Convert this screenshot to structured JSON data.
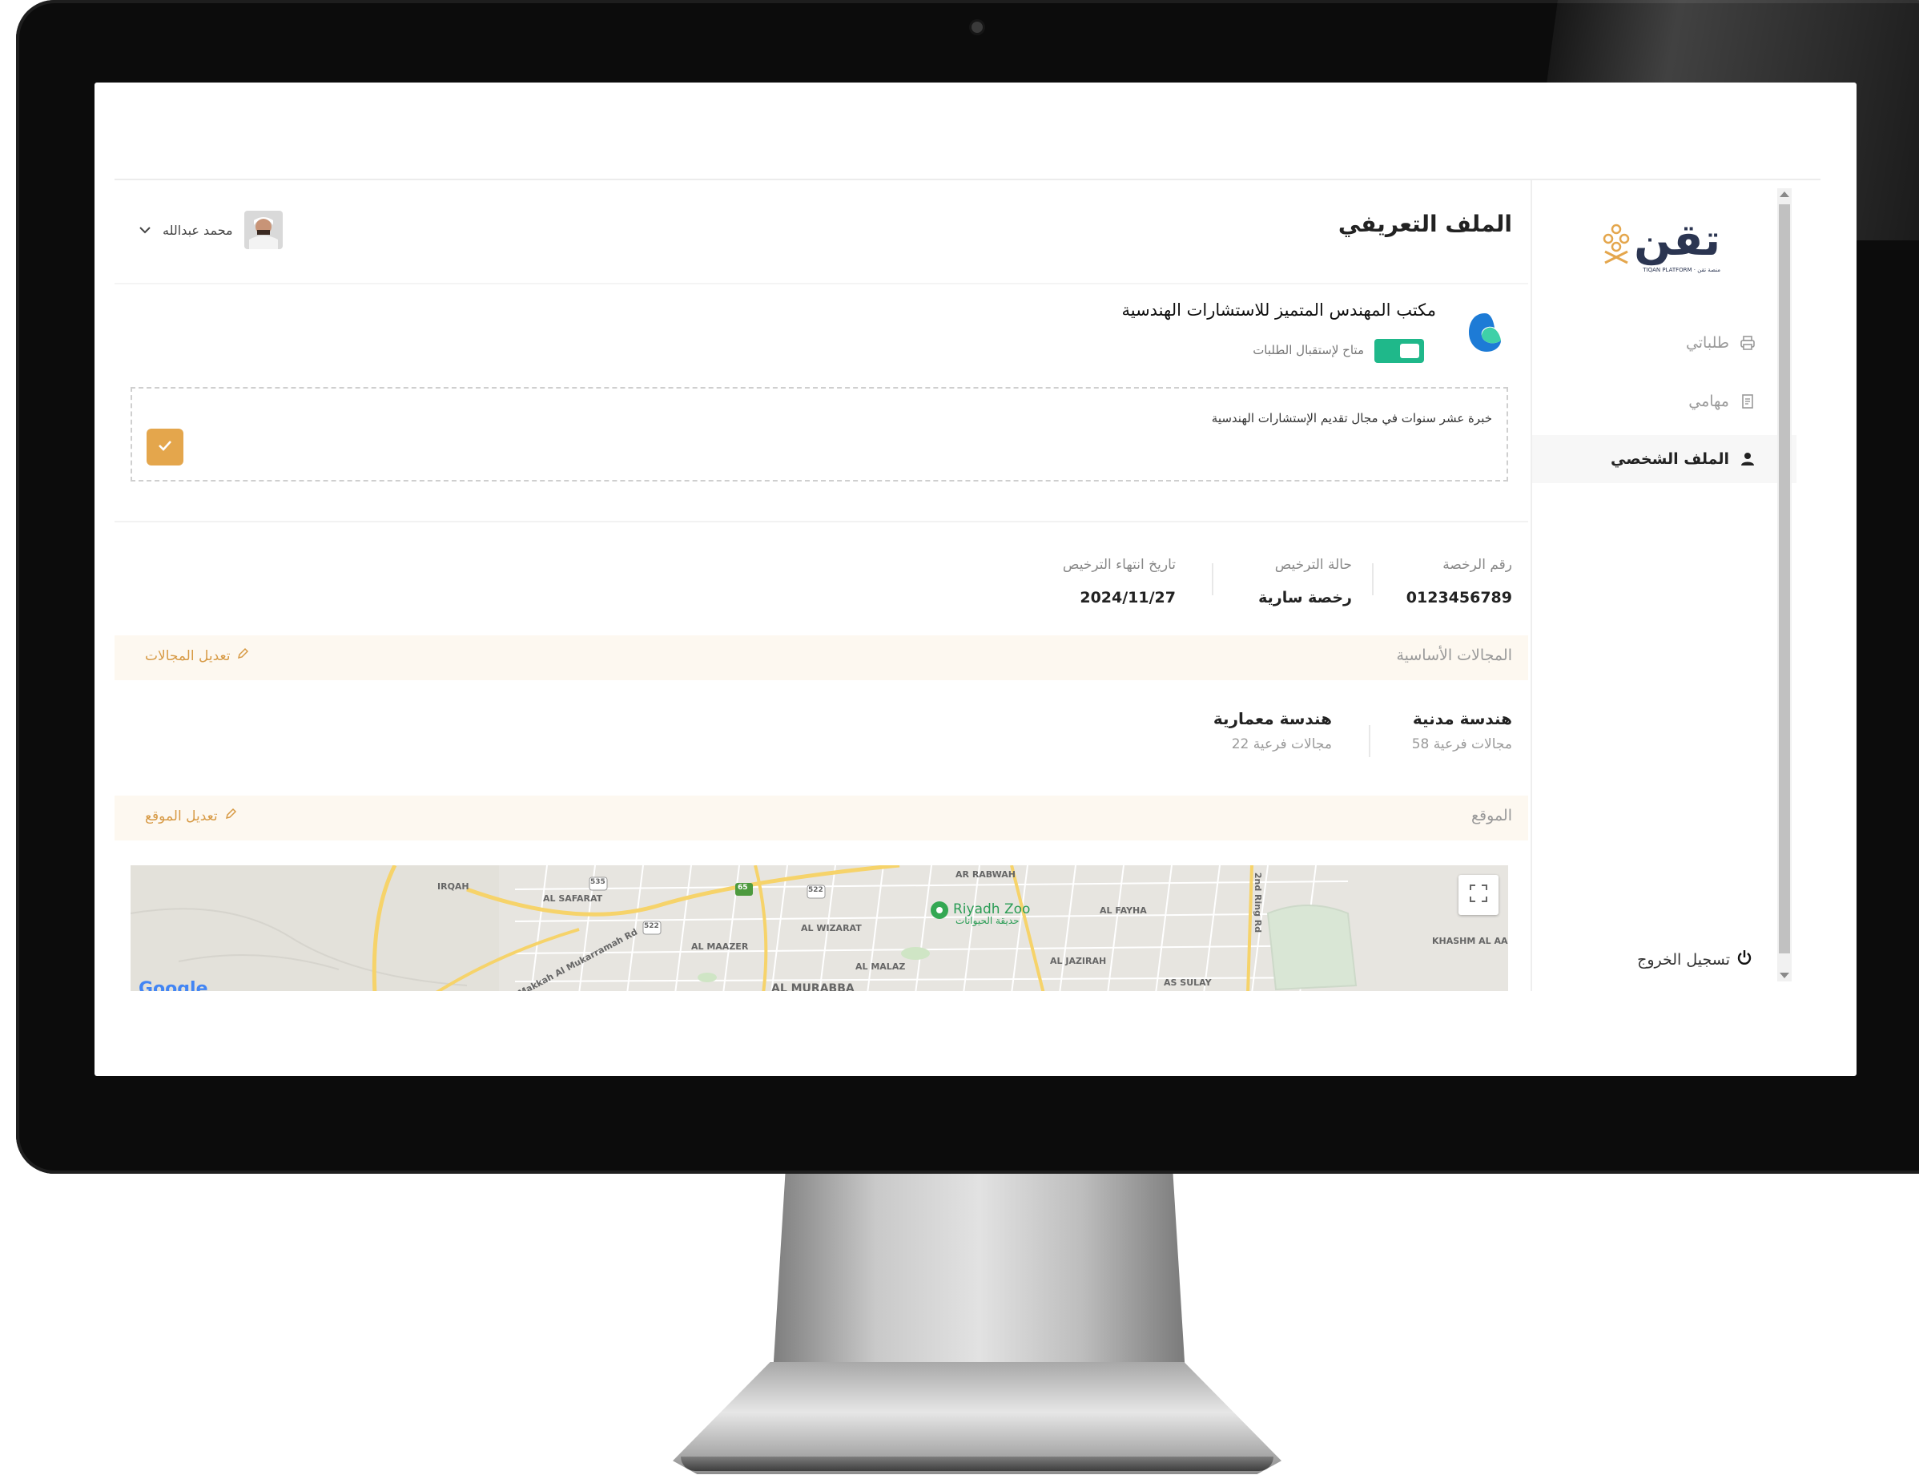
{
  "app": {
    "logo_text": "تقن",
    "logo_subtitle": "TIQAN PLATFORM · منصة تقن",
    "page_title": "الملف التعريفي"
  },
  "user": {
    "name": "محمد عبدالله"
  },
  "sidebar": {
    "items": [
      {
        "label": "طلباتي",
        "icon": "printer-icon",
        "active": false
      },
      {
        "label": "مهامي",
        "icon": "document-icon",
        "active": false
      },
      {
        "label": "الملف الشخصي",
        "icon": "user-icon",
        "active": true
      }
    ],
    "logout_label": "تسجيل الخروج"
  },
  "office": {
    "name": "مكتب المهندس المتميز للاستشارات الهندسية",
    "toggle_label": "متاح لإستقبال الطلبات",
    "toggle_on": true,
    "bio": "خبرة عشر سنوات في مجال تقديم الإستشارات الهندسية"
  },
  "license": {
    "number_label": "رقم الرخصة",
    "number_value": "0123456789",
    "status_label": "حالة الترخيص",
    "status_value": "رخصة سارية",
    "expiry_label": "تاريخ انتهاء الترخيص",
    "expiry_value": "2024/11/27"
  },
  "domains": {
    "section_title": "المجالات الأساسية",
    "edit_label": "تعديل المجالات",
    "items": [
      {
        "name": "هندسة مدنية",
        "sub": "58 مجالات فرعية"
      },
      {
        "name": "هندسة معمارية",
        "sub": "22 مجالات فرعية"
      }
    ]
  },
  "location": {
    "section_title": "الموقع",
    "edit_label": "تعديل الموقع",
    "map": {
      "labels": [
        "IRQAH",
        "AL SAFARAT",
        "AL WIZARAT",
        "AL MAAZER",
        "AL MALAZ",
        "AL JAZIRAH",
        "AL FAYHA",
        "AR RABWAH",
        "KHASHM AL AAN",
        "AS SULAY",
        "AL MURABBA",
        "Makkah Al Mukarramah Rd",
        "2nd Ring Rd"
      ],
      "zoo_label": "Riyadh Zoo",
      "zoo_sub": "حديقة الحيوانات",
      "road_shields": [
        "535",
        "65",
        "522",
        "522"
      ],
      "attribution": "Google"
    }
  },
  "colors": {
    "accent": "#e4a64c",
    "toggle": "#1fb88a",
    "section_bg": "#fdf8f0",
    "brand_dark": "#2b3551"
  }
}
